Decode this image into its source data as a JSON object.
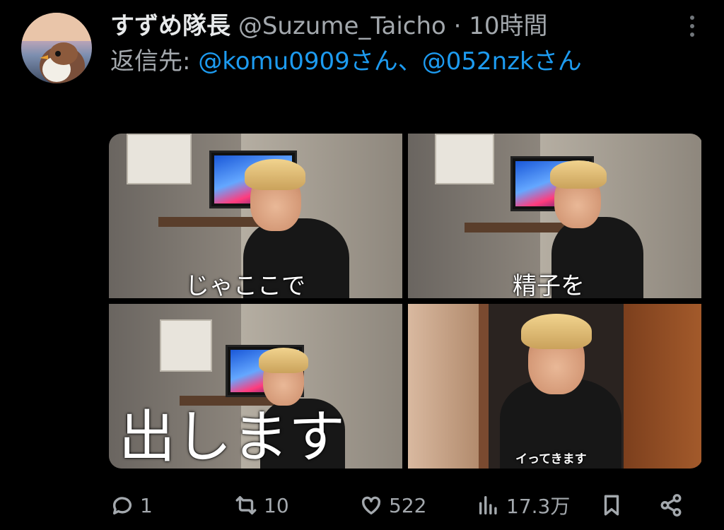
{
  "tweet": {
    "author_name": "すずめ隊長",
    "author_handle": "@Suzume_Taicho",
    "separator": "·",
    "time_ago": "10時間",
    "reply_prefix": "返信先: ",
    "reply_mention_1": "@komu0909さん",
    "reply_joiner": "、",
    "reply_mention_2": "@052nzkさん"
  },
  "media": {
    "captions": [
      "じゃここで",
      "精子を",
      "出します",
      "イってきます"
    ]
  },
  "actions": {
    "replies": "1",
    "retweets": "10",
    "likes": "522",
    "views": "17.3万"
  },
  "icons": [
    "more-icon",
    "reply-icon",
    "retweet-icon",
    "like-icon",
    "views-icon",
    "bookmark-icon",
    "share-icon"
  ],
  "colors": {
    "background": "#000000",
    "link": "#1d9bf0",
    "muted": "#a3a8ad"
  }
}
